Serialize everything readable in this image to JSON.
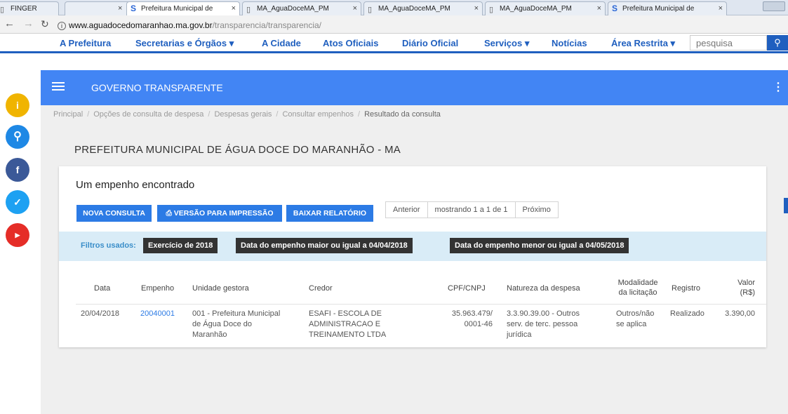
{
  "browser": {
    "tabs": [
      {
        "label": "FINGER",
        "icon": "doc"
      },
      {
        "label": "Prefeitura Municipal de",
        "icon": "s"
      },
      {
        "label": "MA_AguaDoceMA_PM",
        "icon": "doc"
      },
      {
        "label": "MA_AguaDoceMA_PM",
        "icon": "doc"
      },
      {
        "label": "MA_AguaDoceMA_PM",
        "icon": "doc"
      },
      {
        "label": "Prefeitura Municipal de",
        "icon": "s"
      }
    ],
    "url_host": "www.aguadocedomaranhao.ma.gov.br",
    "url_path": "/transparencia/transparencia/"
  },
  "sitenav": {
    "items": [
      "A Prefeitura",
      "Secretarias e Órgãos ▾",
      "A Cidade",
      "Atos Oficiais",
      "Diário Oficial",
      "Serviços ▾",
      "Notícias",
      "Área Restrita ▾"
    ],
    "search_placeholder": "pesquisa"
  },
  "app": {
    "title": "GOVERNO TRANSPARENTE"
  },
  "breadcrumb": [
    "Principal",
    "Opções de consulta de despesa",
    "Despesas gerais",
    "Consultar empenhos",
    "Resultado da consulta"
  ],
  "page_title": "PREFEITURA MUNICIPAL DE ÁGUA DOCE DO MARANHÃO - MA",
  "card": {
    "heading": "Um empenho encontrado",
    "buttons": {
      "new": "NOVA CONSULTA",
      "print": "VERSÃO PARA IMPRESSÃO",
      "download": "BAIXAR RELATÓRIO"
    },
    "pager": {
      "prev": "Anterior",
      "status": "mostrando 1 a 1 de 1",
      "next": "Próximo"
    },
    "filters_label": "Filtros usados:",
    "filters": [
      "Exercício de 2018",
      "Data do empenho maior ou igual a 04/04/2018",
      "Data do empenho menor ou igual a 04/05/2018"
    ]
  },
  "table": {
    "headers": {
      "data": "Data",
      "empenho": "Empenho",
      "unidade": "Unidade gestora",
      "credor": "Credor",
      "cpf": "CPF/CNPJ",
      "natureza": "Natureza da despesa",
      "modalidade1": "Modalidade",
      "modalidade2": "da licitação",
      "registro": "Registro",
      "valor1": "Valor",
      "valor2": "(R$)"
    },
    "row": {
      "data": "20/04/2018",
      "empenho": "20040001",
      "unidade": [
        "001 - Prefeitura Municipal",
        "de Água Doce do",
        "Maranhão"
      ],
      "credor": [
        "ESAFI - ESCOLA DE",
        "ADMINISTRACAO E",
        "TREINAMENTO LTDA"
      ],
      "cpf": [
        "35.963.479/",
        "0001-46"
      ],
      "natureza": [
        "3.3.90.39.00 - Outros",
        "serv. de terc. pessoa",
        "jurídica"
      ],
      "modalidade": [
        "Outros/não",
        "se aplica"
      ],
      "registro": "Realizado",
      "valor": "3.390,00"
    }
  },
  "colors": {
    "brand": "#4285f4",
    "nav": "#1f5fbf",
    "button": "#2c7be5",
    "filters_bg": "#d9ecf7"
  }
}
